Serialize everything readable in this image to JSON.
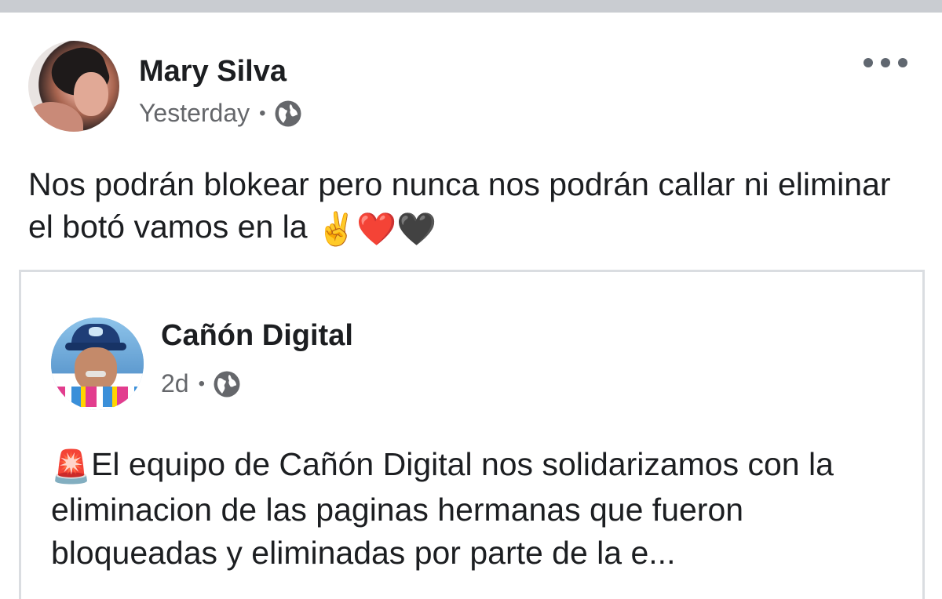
{
  "post": {
    "author": "Mary Silva",
    "time": "Yesterday",
    "separator": "•",
    "privacy_icon": "globe-icon",
    "more_icon": "more-horizontal-icon",
    "text": "Nos podrán blokear pero nunca nos podrán callar ni eliminar el botó vamos en la",
    "emojis": [
      "✌️",
      "❤️",
      "🖤"
    ]
  },
  "shared_post": {
    "author": "Cañón Digital",
    "time": "2d",
    "separator": "•",
    "privacy_icon": "globe-icon",
    "leading_emoji": "🚨",
    "text": "El equipo de Cañón Digital nos solidarizamos con la eliminacion de las paginas hermanas que fueron bloqueadas y eliminadas por parte de la e..."
  },
  "colors": {
    "text_primary": "#1c1e21",
    "text_secondary": "#65676b",
    "card_border": "#dadde1",
    "top_bar": "#c9ccd1"
  }
}
